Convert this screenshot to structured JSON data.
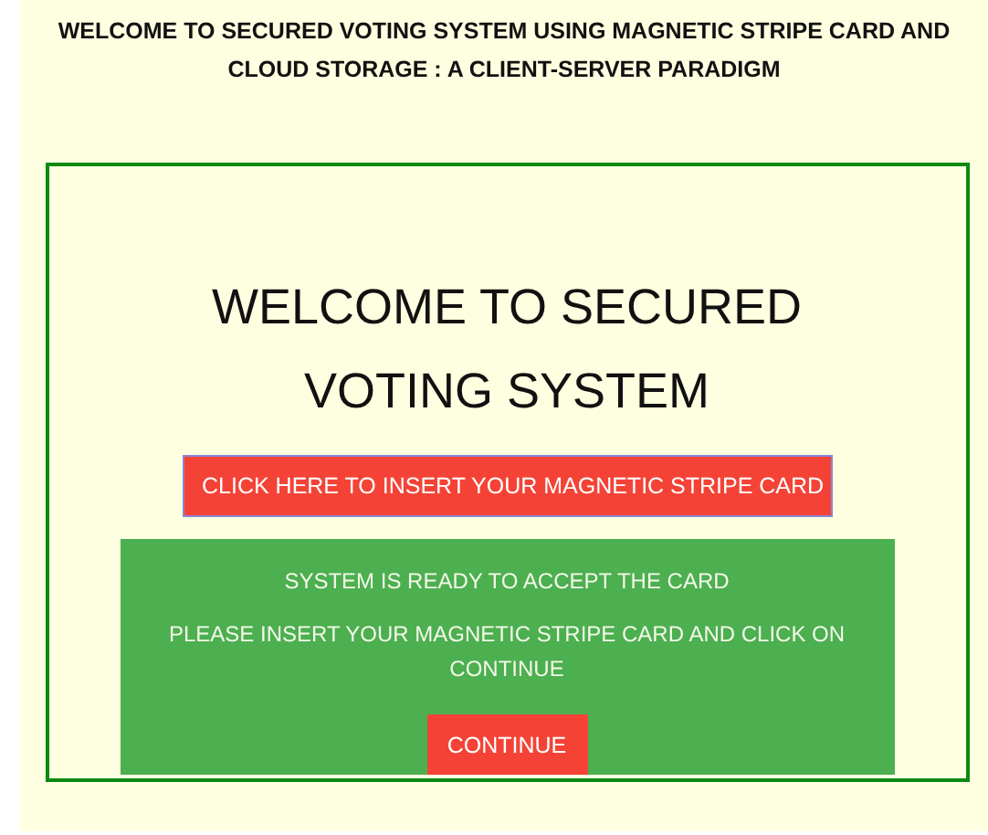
{
  "header": {
    "title": "WELCOME TO SECURED VOTING SYSTEM USING MAGNETIC STRIPE CARD AND CLOUD STORAGE : A CLIENT-SERVER PARADIGM"
  },
  "main": {
    "heading": "WELCOME TO SECURED VOTING SYSTEM",
    "insert_button": "CLICK HERE TO INSERT YOUR MAGNETIC STRIPE CARD",
    "status_panel": {
      "status": "SYSTEM IS READY TO ACCEPT THE CARD",
      "instruction": "PLEASE INSERT YOUR MAGNETIC STRIPE CARD AND CLICK ON CONTINUE",
      "continue_button": "CONTINUE"
    }
  }
}
